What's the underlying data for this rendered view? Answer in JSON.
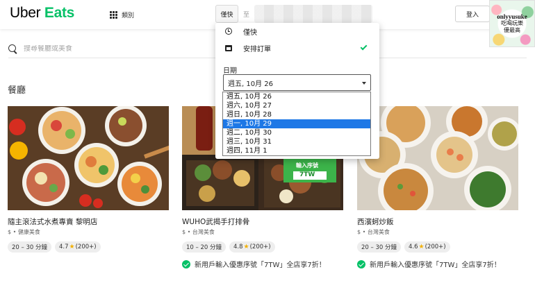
{
  "header": {
    "logo_uber": "Uber",
    "logo_eats": "Eats",
    "category_label": "類別",
    "deliver_label": "僅快",
    "to_label": "至",
    "login_label": "登入",
    "promo_line1": "onlyyusuke",
    "promo_line2": "吃喝玩樂",
    "promo_line3": "優最高"
  },
  "search": {
    "placeholder": "搜尋餐廳或美食"
  },
  "section_title": "餐廳",
  "restaurants": [
    {
      "name": "隨主滾法式水煮專賣 黎明店",
      "category": "$ • 健康美食",
      "eta": "20 – 30 分鐘",
      "rating": "4.7",
      "reviews": "(200+)"
    },
    {
      "name": "WUHO武揭手打排骨",
      "category": "$ • 台灣美食",
      "eta": "10 – 20 分鐘",
      "rating": "4.8",
      "reviews": "(200+)",
      "offer": "新用戶輸入優惠序號「7TW」全店享7折！",
      "overlay_line1": "輸入序號",
      "overlay_line2": "7TW"
    },
    {
      "name": "西濱蚵炒飯",
      "category": "$ • 台灣美食",
      "eta": "20 – 30 分鐘",
      "rating": "4.6",
      "reviews": "(200+)",
      "offer": "新用戶輸入優惠序號「7TW」全店享7折！"
    }
  ],
  "schedule_panel": {
    "option_now": "僅快",
    "option_schedule": "安排訂單",
    "selected_option": "安排訂單",
    "date_label": "日期",
    "selected_date": "週五, 10月 26",
    "date_options": [
      "週五, 10月 26",
      "週六, 10月 27",
      "週日, 10月 28",
      "週一, 10月 29",
      "週二, 10月 30",
      "週三, 10月 31",
      "週四, 11月 1"
    ],
    "highlighted_index": 3
  },
  "colors": {
    "brand_green": "#06c167",
    "highlight_blue": "#1e78e6",
    "star": "#f2b000"
  }
}
